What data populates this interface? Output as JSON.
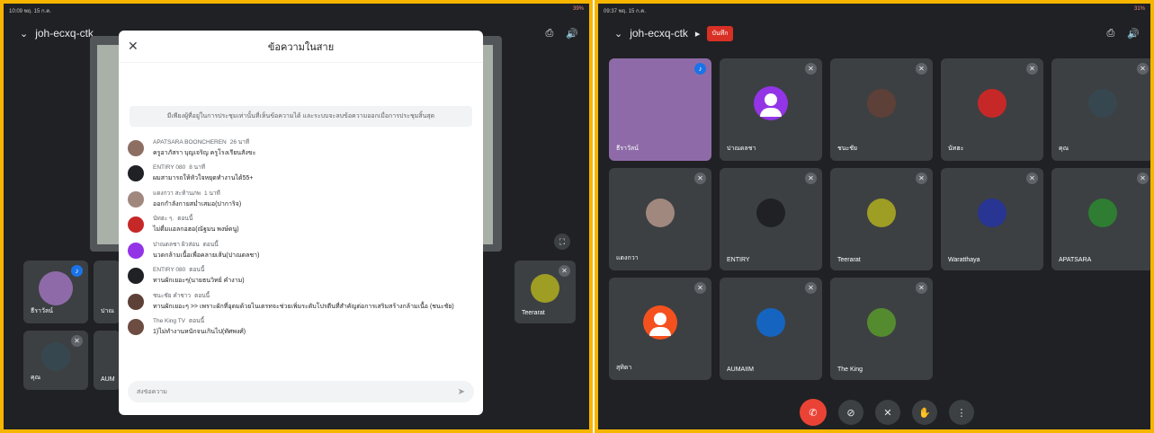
{
  "left": {
    "status": {
      "time": "10:09",
      "date": "พฤ. 15 ก.ค.",
      "battery": "39%"
    },
    "meeting_code": "joh-ecxq-ctk",
    "chat": {
      "title": "ข้อความในสาย",
      "notice": "มีเพียงผู้ที่อยู่ในการประชุมเท่านั้นที่เห็นข้อความได้ และระบบจะลบข้อความออกเมื่อการประชุมสิ้นสุด",
      "placeholder": "ส่งข้อความ",
      "messages": [
        {
          "sender": "APATSARA BOONCHEREN",
          "time": "26 นาที",
          "text": "ครูอาภัสรา บุญเจริญ ครูโรงเรียนสังขะ",
          "color": "#8d6e63"
        },
        {
          "sender": "ENTIRY 080",
          "time": "8 นาที",
          "text": "ผมสามารถให้หัวใจหยุดทำงานได้55+",
          "color": "#202124"
        },
        {
          "sender": "แดงกวา สะท้านภพ",
          "time": "1 นาที",
          "text": "ออกกำลังกายสม่ำเสมอ(ปาการิจ)",
          "color": "#a1887f"
        },
        {
          "sender": "นัทฮะ ๆ.",
          "time": "ตอนนี้",
          "text": "ไม่ดื่มแอลกอฮอ(ณัฐมน พงษ์ดนู)",
          "color": "#c62828"
        },
        {
          "sender": "ปาณดลชา ผิวส่อน",
          "time": "ตอนนี้",
          "text": "นวดกล้ามเนื้อเพื่อคลายเส้น(ปาณดลชา)",
          "color": "#9334e6"
        },
        {
          "sender": "ENTIRY 080",
          "time": "ตอนนี้",
          "text": "ทานผักเยอะๆ(นายธนวิทย์ คำงาม)",
          "color": "#202124"
        },
        {
          "sender": "ชนะชัย คำชาว",
          "time": "ตอนนี้",
          "text": "ทานผักเยอะๆ >> เพราะผักที่อุดมด้วยไนเตรทจะช่วยเพิ่มระดับโปรตีนที่สำคัญต่อการเสริมสร้างกล้ามเนื้อ (ชนะชัย)",
          "color": "#5d4037"
        },
        {
          "sender": "The King TV",
          "time": "ตอนนี้",
          "text": "1)ไม่ทำงานหนักจนเกินไป(ทัศพงศ์)",
          "color": "#6d4c41"
        }
      ]
    },
    "tiles": [
      {
        "name": "ธีราวัลน์",
        "color": "#8e6ba8"
      },
      {
        "name": "ปาณ",
        "color": "#9334e6"
      },
      {
        "name": "Teerarat",
        "color": "#9e9d24"
      },
      {
        "name": "คุณ",
        "color": "#37474f"
      },
      {
        "name": "AUM",
        "color": "#455a64"
      }
    ]
  },
  "right": {
    "status": {
      "time": "09:37",
      "date": "พฤ. 15 ก.ค.",
      "battery": "31%"
    },
    "meeting_code": "joh-ecxq-ctk",
    "rec_label": "บันทึก",
    "tiles": [
      {
        "name": "ธีราวัลน์",
        "color": "#8e6ba8"
      },
      {
        "name": "ปาณดลชา",
        "color": "#9334e6"
      },
      {
        "name": "ชนะชัย",
        "color": "#5d4037"
      },
      {
        "name": "นัทฮะ",
        "color": "#c62828"
      },
      {
        "name": "คุณ",
        "color": "#37474f"
      },
      {
        "name": "แดงกวา",
        "color": "#a1887f"
      },
      {
        "name": "ENTIRY",
        "color": "#202124"
      },
      {
        "name": "Teerarat",
        "color": "#9e9d24"
      },
      {
        "name": "Waratthaya",
        "color": "#283593"
      },
      {
        "name": "APATSARA",
        "color": "#2e7d32"
      },
      {
        "name": "สุทิตา",
        "color": "#f4511e"
      },
      {
        "name": "AUMAIIM",
        "color": "#1565c0"
      },
      {
        "name": "The King",
        "color": "#558b2f"
      }
    ]
  }
}
